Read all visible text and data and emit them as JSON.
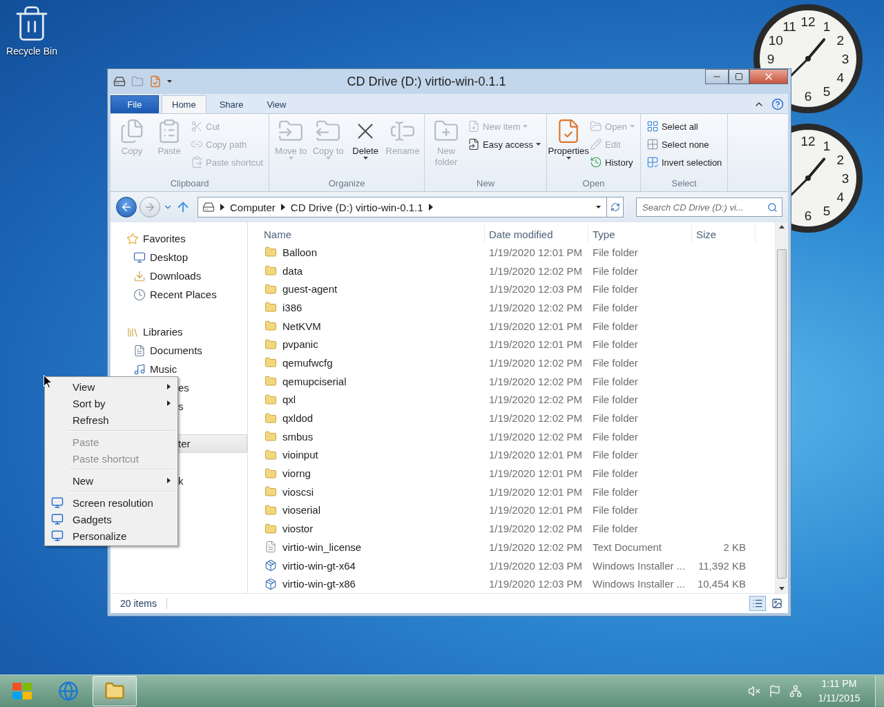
{
  "desktop": {
    "icons": [
      {
        "label": "Recycle Bin"
      }
    ]
  },
  "window": {
    "title": "CD Drive (D:) virtio-win-0.1.1",
    "ribbon_tabs": [
      {
        "label": "File",
        "kind": "file",
        "selected": false
      },
      {
        "label": "Home",
        "kind": "tab",
        "selected": true
      },
      {
        "label": "Share",
        "kind": "tab",
        "selected": false
      },
      {
        "label": "View",
        "kind": "tab",
        "selected": false
      }
    ],
    "ribbon_groups": [
      {
        "label": "Clipboard",
        "items": [
          {
            "label": "Copy",
            "kind": "large",
            "disabled": true,
            "dropdown": false
          },
          {
            "label": "Paste",
            "kind": "large",
            "disabled": true,
            "dropdown": false
          },
          {
            "label": "Cut",
            "kind": "small",
            "disabled": true,
            "dropdown": false
          },
          {
            "label": "Copy path",
            "kind": "small",
            "disabled": true,
            "dropdown": false
          },
          {
            "label": "Paste shortcut",
            "kind": "small",
            "disabled": true,
            "dropdown": false
          }
        ]
      },
      {
        "label": "Organize",
        "items": [
          {
            "label": "Move to",
            "kind": "large",
            "disabled": true,
            "dropdown": true
          },
          {
            "label": "Copy to",
            "kind": "large",
            "disabled": true,
            "dropdown": true
          },
          {
            "label": "Delete",
            "kind": "large",
            "disabled": false,
            "dropdown": true
          },
          {
            "label": "Rename",
            "kind": "large",
            "disabled": true,
            "dropdown": false
          }
        ]
      },
      {
        "label": "New",
        "items": [
          {
            "label": "New folder",
            "kind": "large",
            "disabled": true,
            "dropdown": false
          },
          {
            "label": "New item",
            "kind": "small",
            "disabled": true,
            "dropdown": true
          },
          {
            "label": "Easy access",
            "kind": "small",
            "disabled": false,
            "dropdown": true
          }
        ]
      },
      {
        "label": "Open",
        "items": [
          {
            "label": "Properties",
            "kind": "large",
            "disabled": false,
            "dropdown": true
          },
          {
            "label": "Open",
            "kind": "small",
            "disabled": true,
            "dropdown": true
          },
          {
            "label": "Edit",
            "kind": "small",
            "disabled": true,
            "dropdown": false
          },
          {
            "label": "History",
            "kind": "small",
            "disabled": false,
            "dropdown": false
          }
        ]
      },
      {
        "label": "Select",
        "items": [
          {
            "label": "Select all",
            "kind": "small",
            "disabled": false,
            "dropdown": false
          },
          {
            "label": "Select none",
            "kind": "small",
            "disabled": false,
            "dropdown": false
          },
          {
            "label": "Invert selection",
            "kind": "small",
            "disabled": false,
            "dropdown": false
          }
        ]
      }
    ],
    "address": {
      "crumbs": [
        "Computer",
        "CD Drive (D:) virtio-win-0.1.1"
      ]
    },
    "search": {
      "placeholder": "Search CD Drive (D:) vi..."
    },
    "navigation": [
      {
        "label": "Favorites",
        "kind": "favorites",
        "selected": false,
        "children": [
          {
            "label": "Desktop",
            "kind": "desktop",
            "selected": false
          },
          {
            "label": "Downloads",
            "kind": "downloads",
            "selected": false
          },
          {
            "label": "Recent Places",
            "kind": "recent",
            "selected": false
          }
        ]
      },
      {
        "label": "Libraries",
        "kind": "libraries",
        "selected": false,
        "children": [
          {
            "label": "Documents",
            "kind": "documents",
            "selected": false
          },
          {
            "label": "Music",
            "kind": "music",
            "selected": false
          },
          {
            "label": "es",
            "kind": "partial",
            "selected": false
          },
          {
            "label": "s",
            "kind": "partial",
            "selected": false
          }
        ]
      },
      {
        "label": "ter",
        "kind": "partial",
        "selected": true
      },
      {
        "label": "k",
        "kind": "partial",
        "selected": false
      }
    ],
    "file_list": {
      "columns": [
        "Name",
        "Date modified",
        "Type",
        "Size"
      ],
      "rows": [
        {
          "name": "Balloon",
          "date": "1/19/2020 12:01 PM",
          "type": "File folder",
          "kind": "folder"
        },
        {
          "name": "data",
          "date": "1/19/2020 12:02 PM",
          "type": "File folder",
          "kind": "folder"
        },
        {
          "name": "guest-agent",
          "date": "1/19/2020 12:03 PM",
          "type": "File folder",
          "kind": "folder"
        },
        {
          "name": "i386",
          "date": "1/19/2020 12:02 PM",
          "type": "File folder",
          "kind": "folder"
        },
        {
          "name": "NetKVM",
          "date": "1/19/2020 12:01 PM",
          "type": "File folder",
          "kind": "folder"
        },
        {
          "name": "pvpanic",
          "date": "1/19/2020 12:01 PM",
          "type": "File folder",
          "kind": "folder"
        },
        {
          "name": "qemufwcfg",
          "date": "1/19/2020 12:02 PM",
          "type": "File folder",
          "kind": "folder"
        },
        {
          "name": "qemupciserial",
          "date": "1/19/2020 12:02 PM",
          "type": "File folder",
          "kind": "folder"
        },
        {
          "name": "qxl",
          "date": "1/19/2020 12:02 PM",
          "type": "File folder",
          "kind": "folder"
        },
        {
          "name": "qxldod",
          "date": "1/19/2020 12:02 PM",
          "type": "File folder",
          "kind": "folder"
        },
        {
          "name": "smbus",
          "date": "1/19/2020 12:02 PM",
          "type": "File folder",
          "kind": "folder"
        },
        {
          "name": "vioinput",
          "date": "1/19/2020 12:01 PM",
          "type": "File folder",
          "kind": "folder"
        },
        {
          "name": "viorng",
          "date": "1/19/2020 12:01 PM",
          "type": "File folder",
          "kind": "folder"
        },
        {
          "name": "vioscsi",
          "date": "1/19/2020 12:01 PM",
          "type": "File folder",
          "kind": "folder"
        },
        {
          "name": "vioserial",
          "date": "1/19/2020 12:01 PM",
          "type": "File folder",
          "kind": "folder"
        },
        {
          "name": "viostor",
          "date": "1/19/2020 12:02 PM",
          "type": "File folder",
          "kind": "folder"
        },
        {
          "name": "virtio-win_license",
          "date": "1/19/2020 12:02 PM",
          "type": "Text Document",
          "size": "2 KB",
          "kind": "text"
        },
        {
          "name": "virtio-win-gt-x64",
          "date": "1/19/2020 12:03 PM",
          "type": "Windows Installer ...",
          "size": "11,392 KB",
          "kind": "installer"
        },
        {
          "name": "virtio-win-gt-x86",
          "date": "1/19/2020 12:03 PM",
          "type": "Windows Installer ...",
          "size": "10,454 KB",
          "kind": "installer"
        }
      ]
    },
    "status_bar": {
      "count": "20 items"
    }
  },
  "clocks": [
    {
      "numerals": [
        "11",
        "12",
        "1",
        "10",
        "2",
        "9",
        "3",
        "4",
        "5",
        "6"
      ]
    },
    {
      "numerals": [
        "12",
        "1",
        "2",
        "3",
        "4",
        "5",
        "6"
      ]
    }
  ],
  "context_menu": [
    {
      "kind": "item",
      "label": "View",
      "submenu": true,
      "disabled": false
    },
    {
      "kind": "item",
      "label": "Sort by",
      "submenu": true,
      "disabled": false
    },
    {
      "kind": "item",
      "label": "Refresh",
      "submenu": false,
      "disabled": false
    },
    {
      "kind": "separator"
    },
    {
      "kind": "item",
      "label": "Paste",
      "submenu": false,
      "disabled": true
    },
    {
      "kind": "item",
      "label": "Paste shortcut",
      "submenu": false,
      "disabled": true
    },
    {
      "kind": "separator"
    },
    {
      "kind": "item",
      "label": "New",
      "submenu": true,
      "disabled": false
    },
    {
      "kind": "separator"
    },
    {
      "kind": "iconed",
      "label": "Screen resolution",
      "submenu": false,
      "disabled": false
    },
    {
      "kind": "iconed",
      "label": "Gadgets",
      "submenu": false,
      "disabled": false
    },
    {
      "kind": "iconed",
      "label": "Personalize",
      "submenu": false,
      "disabled": false
    }
  ],
  "taskbar": {
    "apps": [
      {
        "kind": "browser",
        "active": false
      },
      {
        "kind": "explorer",
        "active": true
      }
    ],
    "time": "1:11 PM",
    "date": "1/11/2015"
  }
}
